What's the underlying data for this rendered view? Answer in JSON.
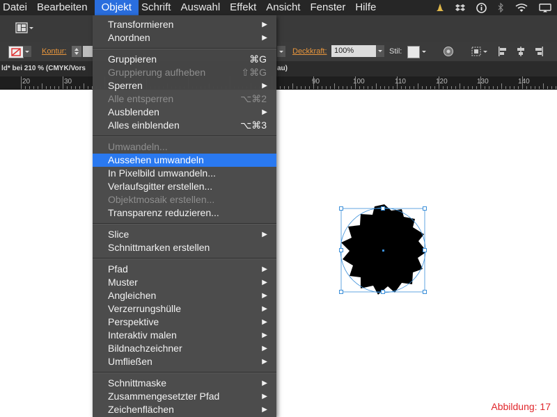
{
  "menubar": {
    "items": [
      "Datei",
      "Bearbeiten",
      "Objekt",
      "Schrift",
      "Auswahl",
      "Effekt",
      "Ansicht",
      "Fenster",
      "Hilfe"
    ],
    "active": "Objekt",
    "status_icons": [
      "bell-icon",
      "dropbox-icon",
      "info-icon",
      "bluetooth-icon",
      "wifi-icon",
      "display-icon"
    ]
  },
  "control_bar": {
    "kontur_label": "Kontur:",
    "deckkraft_label": "Deckkraft:",
    "deckkraft_value": "100%",
    "stil_label": "Stil:"
  },
  "document_tab": {
    "title_left": "ld* bei 210 % (CMYK/Vors",
    "title_right": "au)"
  },
  "ruler": {
    "labels": [
      "20",
      "30",
      "90",
      "100",
      "110",
      "120",
      "130",
      "140"
    ]
  },
  "menu": {
    "items": [
      {
        "label": "Transformieren",
        "submenu": true,
        "disabled": false
      },
      {
        "label": "Anordnen",
        "submenu": true,
        "disabled": false
      },
      {
        "label": "Gruppieren",
        "shortcut": "⌘G",
        "disabled": false
      },
      {
        "label": "Gruppierung aufheben",
        "shortcut": "⇧⌘G",
        "disabled": true
      },
      {
        "label": "Sperren",
        "submenu": true,
        "disabled": false
      },
      {
        "label": "Alle entsperren",
        "shortcut": "⌥⌘2",
        "disabled": true
      },
      {
        "label": "Ausblenden",
        "submenu": true,
        "disabled": false
      },
      {
        "label": "Alles einblenden",
        "shortcut": "⌥⌘3",
        "disabled": false
      },
      {
        "label": "Umwandeln...",
        "disabled": true
      },
      {
        "label": "Aussehen umwandeln",
        "disabled": false,
        "highlighted": true
      },
      {
        "label": "In Pixelbild umwandeln...",
        "disabled": false
      },
      {
        "label": "Verlaufsgitter erstellen...",
        "disabled": false
      },
      {
        "label": "Objektmosaik erstellen...",
        "disabled": true
      },
      {
        "label": "Transparenz reduzieren...",
        "disabled": false
      },
      {
        "label": "Slice",
        "submenu": true,
        "disabled": false
      },
      {
        "label": "Schnittmarken erstellen",
        "disabled": false
      },
      {
        "label": "Pfad",
        "submenu": true,
        "disabled": false
      },
      {
        "label": "Muster",
        "submenu": true,
        "disabled": false
      },
      {
        "label": "Angleichen",
        "submenu": true,
        "disabled": false
      },
      {
        "label": "Verzerrungshülle",
        "submenu": true,
        "disabled": false
      },
      {
        "label": "Perspektive",
        "submenu": true,
        "disabled": false
      },
      {
        "label": "Interaktiv malen",
        "submenu": true,
        "disabled": false
      },
      {
        "label": "Bildnachzeichner",
        "submenu": true,
        "disabled": false
      },
      {
        "label": "Umfließen",
        "submenu": true,
        "disabled": false
      },
      {
        "label": "Schnittmaske",
        "submenu": true,
        "disabled": false
      },
      {
        "label": "Zusammengesetzter Pfad",
        "submenu": true,
        "disabled": false
      },
      {
        "label": "Zeichenflächen",
        "submenu": true,
        "disabled": false
      }
    ]
  },
  "caption": "Abbildung: 17",
  "colors": {
    "menubar_bg": "#262626",
    "menu_bg": "#464646",
    "highlight": "#2a79f0",
    "selection": "#3b8fd9",
    "caption": "#e0262b",
    "orange_label": "#e8963c"
  }
}
